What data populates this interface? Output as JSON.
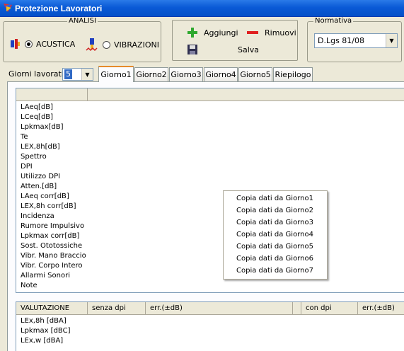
{
  "window": {
    "title": "Protezione Lavoratori",
    "title_icon": "app-icon"
  },
  "analisi": {
    "legend": "ANALISI",
    "options": [
      {
        "label": "ACUSTICA",
        "icon": "acoustic-icon",
        "selected": true
      },
      {
        "label": "VIBRAZIONI",
        "icon": "vibration-icon",
        "selected": false
      }
    ]
  },
  "actions": {
    "add_label": "Aggiungi",
    "add_icon": "plus-icon",
    "remove_label": "Rimuovi",
    "remove_icon": "minus-icon",
    "save_label": "Salva",
    "save_icon": "floppy-disk-icon"
  },
  "normativa": {
    "legend": "Normativa",
    "value": "D.Lgs 81/08"
  },
  "giorni": {
    "label": "Giorni lavorativi",
    "value": "5"
  },
  "tabs": [
    {
      "label": "Giorno1",
      "active": true
    },
    {
      "label": "Giorno2",
      "active": false
    },
    {
      "label": "Giorno3",
      "active": false
    },
    {
      "label": "Giorno4",
      "active": false
    },
    {
      "label": "Giorno5",
      "active": false
    },
    {
      "label": "Riepilogo",
      "active": false
    }
  ],
  "grid1": {
    "rows": [
      "LAeq[dB]",
      "LCeq[dB]",
      "Lpkmax[dB]",
      "Te",
      "LEX,8h[dB]",
      "Spettro",
      "DPI",
      "Utilizzo DPI",
      "Atten.[dB]",
      "LAeq corr[dB]",
      "LEX,8h corr[dB]",
      "Incidenza",
      "Rumore Impulsivo",
      "Lpkmax corr[dB]",
      "Sost. Ototossiche",
      "Vibr. Mano Braccio",
      "Vibr. Corpo Intero",
      "Allarmi Sonori",
      "Note"
    ]
  },
  "grid2": {
    "headers": [
      "VALUTAZIONE",
      "senza dpi",
      "err.(±dB)",
      "",
      "con dpi",
      "err.(±dB)"
    ],
    "rows": [
      "LEx,8h [dBA]",
      "Lpkmax [dBC]",
      "LEx,w [dBA]"
    ]
  },
  "context_menu": {
    "items": [
      "Copia dati da Giorno1",
      "Copia dati da Giorno2",
      "Copia dati da Giorno3",
      "Copia dati da Giorno4",
      "Copia dati da Giorno5",
      "Copia dati da Giorno6",
      "Copia dati da Giorno7"
    ]
  },
  "colors": {
    "titlebar": "#0a5ad6",
    "tab_active_accent": "#e68b2c",
    "add_icon": "#2ea82e",
    "remove_icon": "#e02020"
  }
}
